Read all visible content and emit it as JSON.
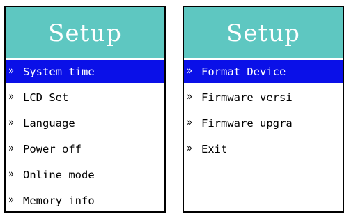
{
  "left_panel": {
    "title": "Setup",
    "items": [
      {
        "icon": "chevron-double-right-icon",
        "glyph": "»",
        "label": "System time",
        "selected": true
      },
      {
        "icon": "chevron-double-right-icon",
        "glyph": "»",
        "label": "LCD Set",
        "selected": false
      },
      {
        "icon": "chevron-double-right-icon",
        "glyph": "»",
        "label": "Language",
        "selected": false
      },
      {
        "icon": "chevron-double-right-icon",
        "glyph": "»",
        "label": "Power off",
        "selected": false
      },
      {
        "icon": "chevron-double-right-icon",
        "glyph": "»",
        "label": "Online mode",
        "selected": false
      },
      {
        "icon": "chevron-double-right-icon",
        "glyph": "»",
        "label": "Memory info",
        "selected": false
      }
    ]
  },
  "right_panel": {
    "title": "Setup",
    "items": [
      {
        "icon": "chevron-double-right-icon",
        "glyph": "»",
        "label": "Format Device",
        "selected": true
      },
      {
        "icon": "chevron-double-right-icon",
        "glyph": "»",
        "label": "Firmware versi",
        "selected": false
      },
      {
        "icon": "chevron-double-right-icon",
        "glyph": "»",
        "label": "Firmware upgra",
        "selected": false
      },
      {
        "icon": "chevron-double-right-icon",
        "glyph": "»",
        "label": "Exit",
        "selected": false
      }
    ]
  },
  "colors": {
    "header_bg": "#5ec7c1",
    "header_text": "#ffffff",
    "selection_bg": "#0a10e8",
    "selection_text": "#ffffff",
    "item_text": "#000000",
    "border": "#000000"
  }
}
